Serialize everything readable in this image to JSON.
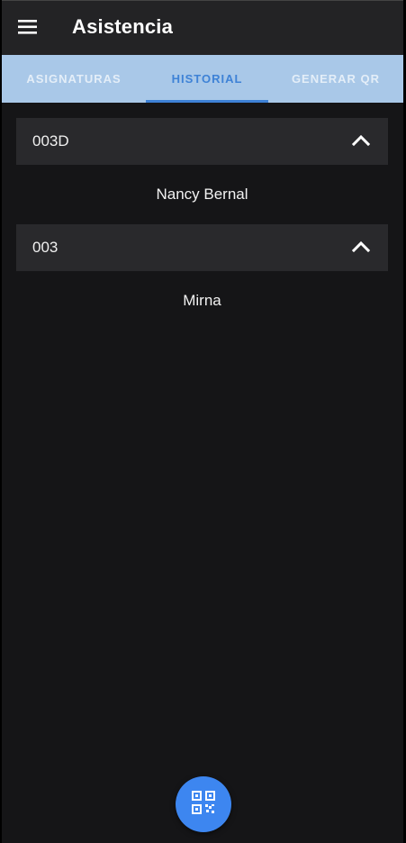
{
  "appbar": {
    "title": "Asistencia",
    "menu_icon": "menu-icon"
  },
  "tabs": [
    {
      "label": "ASIGNATURAS",
      "selected": false
    },
    {
      "label": "HISTORIAL",
      "selected": true
    },
    {
      "label": "GENERAR QR",
      "selected": false
    }
  ],
  "panels": [
    {
      "title": "003D",
      "expanded": true,
      "items": [
        "Nancy Bernal"
      ]
    },
    {
      "title": "003",
      "expanded": true,
      "items": [
        "Mirna"
      ]
    }
  ],
  "fab": {
    "icon": "qr-code-icon"
  },
  "colors": {
    "accent": "#3e82d6",
    "tab_bar": "#a9c8e8",
    "background": "#151517",
    "fab": "#3d86f0"
  }
}
